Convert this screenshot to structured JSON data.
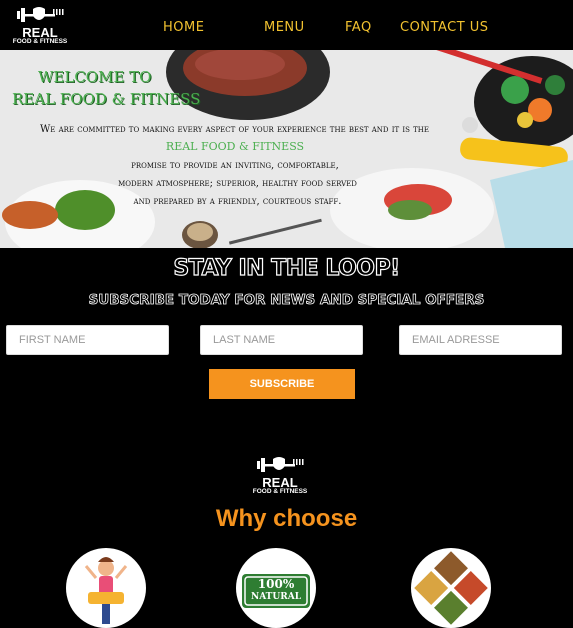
{
  "header": {
    "logo": {
      "line1": "REAL",
      "line2": "FOOD & FITNESS"
    },
    "nav": [
      {
        "label": "HOME"
      },
      {
        "label": "MENU"
      },
      {
        "label": "FAQ"
      },
      {
        "label": "CONTACT US"
      }
    ]
  },
  "hero": {
    "welcome_line1": "WELCOME TO",
    "welcome_line2": "REAL FOOD & FITNESS",
    "paragraph_line1": "We are committed to making every aspect of your experience the best and it is the",
    "paragraph_brand": "REAL FOOD & FITNESS",
    "paragraph_line3": "promise to provide an inviting, comfortable,",
    "paragraph_line4": "modern atmosphere; superior, healthy food served",
    "paragraph_line5": "and prepared by a friendly, courteous staff."
  },
  "newsletter": {
    "title": "STAY IN THE LOOP!",
    "subtitle": "SUBSCRIBE TODAY FOR NEWS AND SPECIAL OFFERS",
    "first_name_placeholder": "FIRST NAME",
    "last_name_placeholder": "LAST NAME",
    "email_placeholder": "EMAIL ADRESSE",
    "subscribe_label": "SUBSCRIBE"
  },
  "footer_logo": {
    "line1": "REAL",
    "line2": "FOOD & FITNESS"
  },
  "why": {
    "title": "Why choose",
    "badge_line1": "100%",
    "badge_line2": "NATURAL"
  },
  "colors": {
    "accent": "#f5931e",
    "nav_text": "#f2c230",
    "welcome_green": "#4caf50",
    "background": "#000000"
  }
}
